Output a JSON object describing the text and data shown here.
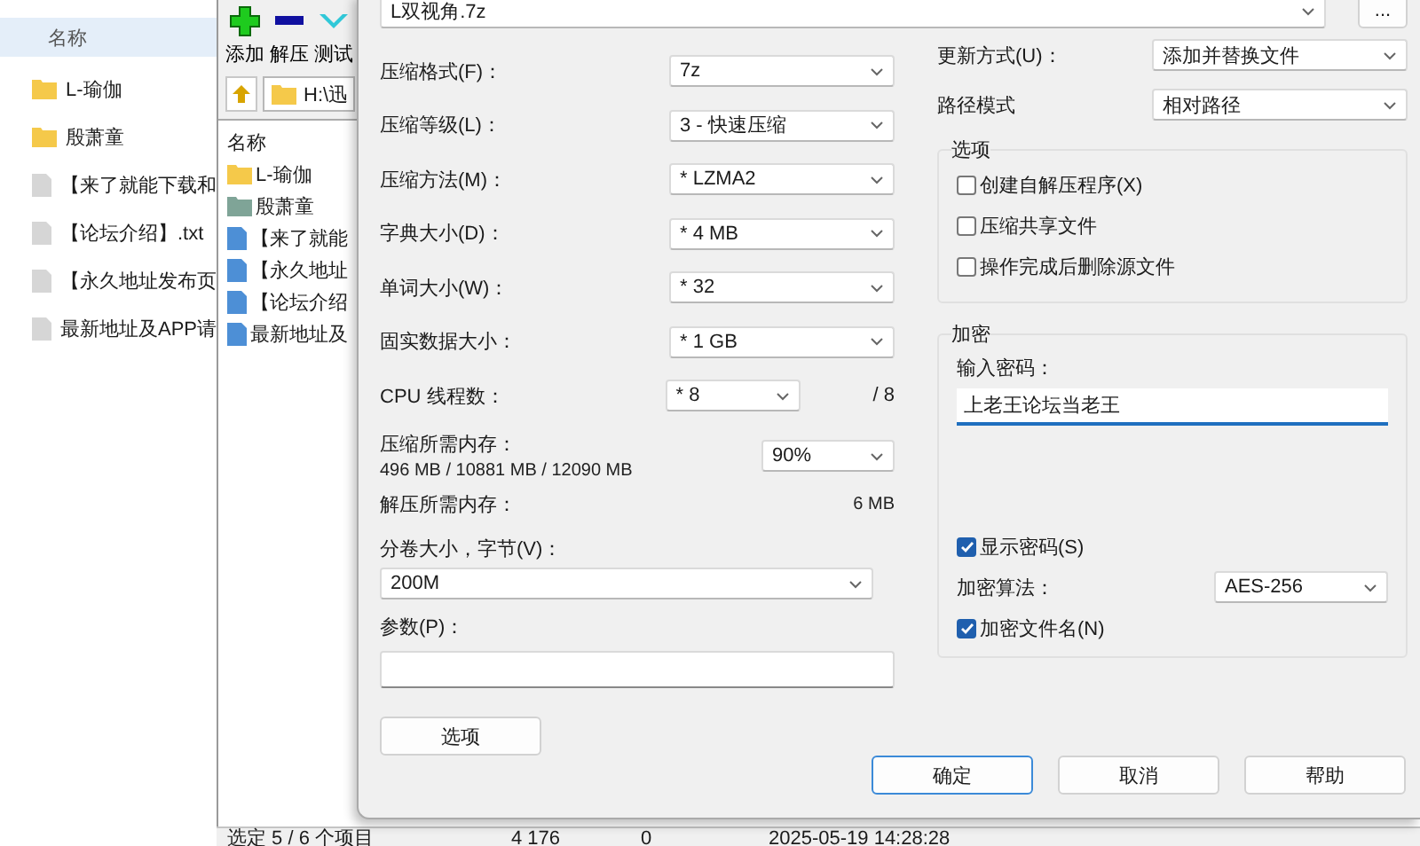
{
  "explorer": {
    "header": "名称",
    "items": [
      {
        "kind": "folder",
        "name": "L-瑜伽"
      },
      {
        "kind": "folder",
        "name": "殷萧童"
      },
      {
        "kind": "file",
        "name": "【来了就能下载和"
      },
      {
        "kind": "file",
        "name": "【论坛介绍】.txt"
      },
      {
        "kind": "file",
        "name": "【永久地址发布页"
      },
      {
        "kind": "file",
        "name": "最新地址及APP请"
      }
    ]
  },
  "archiver": {
    "toolbar": [
      {
        "kind": "add",
        "label": "添加"
      },
      {
        "kind": "extract",
        "label": "解压"
      },
      {
        "kind": "test",
        "label": "测试"
      }
    ],
    "path": "H:\\迅",
    "list_header": "名称",
    "items": [
      {
        "kind": "folder",
        "name": "L-瑜伽",
        "color": "#f5c94a"
      },
      {
        "kind": "folder",
        "name": "殷萧童",
        "color": "#7fa497"
      },
      {
        "kind": "file",
        "name": "【来了就能"
      },
      {
        "kind": "file",
        "name": "【永久地址"
      },
      {
        "kind": "file",
        "name": "【论坛介绍"
      },
      {
        "kind": "file",
        "name": "最新地址及"
      }
    ],
    "status_bar": [
      "选定 5 / 6 个项目",
      "4 176",
      "0",
      "2025-05-19 14:28:28"
    ]
  },
  "dialog": {
    "archive_name": "L双视角.7z",
    "browse_button": "...",
    "settings": [
      {
        "label": "压缩格式(F)：",
        "value": "7z"
      },
      {
        "label": "压缩等级(L)：",
        "value": "3 - 快速压缩"
      },
      {
        "label": "压缩方法(M)：",
        "value": "* LZMA2"
      },
      {
        "label": "字典大小(D)：",
        "value": "* 4 MB"
      },
      {
        "label": "单词大小(W)：",
        "value": "* 32"
      },
      {
        "label": "固实数据大小：",
        "value": "* 1 GB"
      }
    ],
    "cpu_threads": {
      "label": "CPU 线程数：",
      "value": "* 8",
      "max": "/ 8"
    },
    "memory_compress": {
      "label": "压缩所需内存：",
      "value": "496 MB / 10881 MB / 12090 MB",
      "percent": "90%"
    },
    "memory_decompress": {
      "label": "解压所需内存：",
      "value": "6 MB"
    },
    "volume": {
      "label": "分卷大小，字节(V)：",
      "value": "200M"
    },
    "parameters": {
      "label": "参数(P)："
    },
    "options_button": "选项",
    "update_mode": {
      "label": "更新方式(U)：",
      "value": "添加并替换文件"
    },
    "path_mode": {
      "label": "路径模式",
      "value": "相对路径"
    },
    "options_group": {
      "title": "选项",
      "checkboxes": [
        {
          "label": "创建自解压程序(X)",
          "checked": false
        },
        {
          "label": "压缩共享文件",
          "checked": false
        },
        {
          "label": "操作完成后删除源文件",
          "checked": false
        }
      ]
    },
    "encryption": {
      "title": "加密",
      "password_label": "输入密码：",
      "password": "上老王论坛当老王",
      "show_password": {
        "label": "显示密码(S)",
        "checked": true
      },
      "method": {
        "label": "加密算法：",
        "value": "AES-256"
      },
      "encrypt_names": {
        "label": "加密文件名(N)",
        "checked": true
      }
    },
    "buttons": [
      {
        "label": "确定",
        "default": true
      },
      {
        "label": "取消",
        "default": false
      },
      {
        "label": "帮助",
        "default": false
      }
    ]
  }
}
